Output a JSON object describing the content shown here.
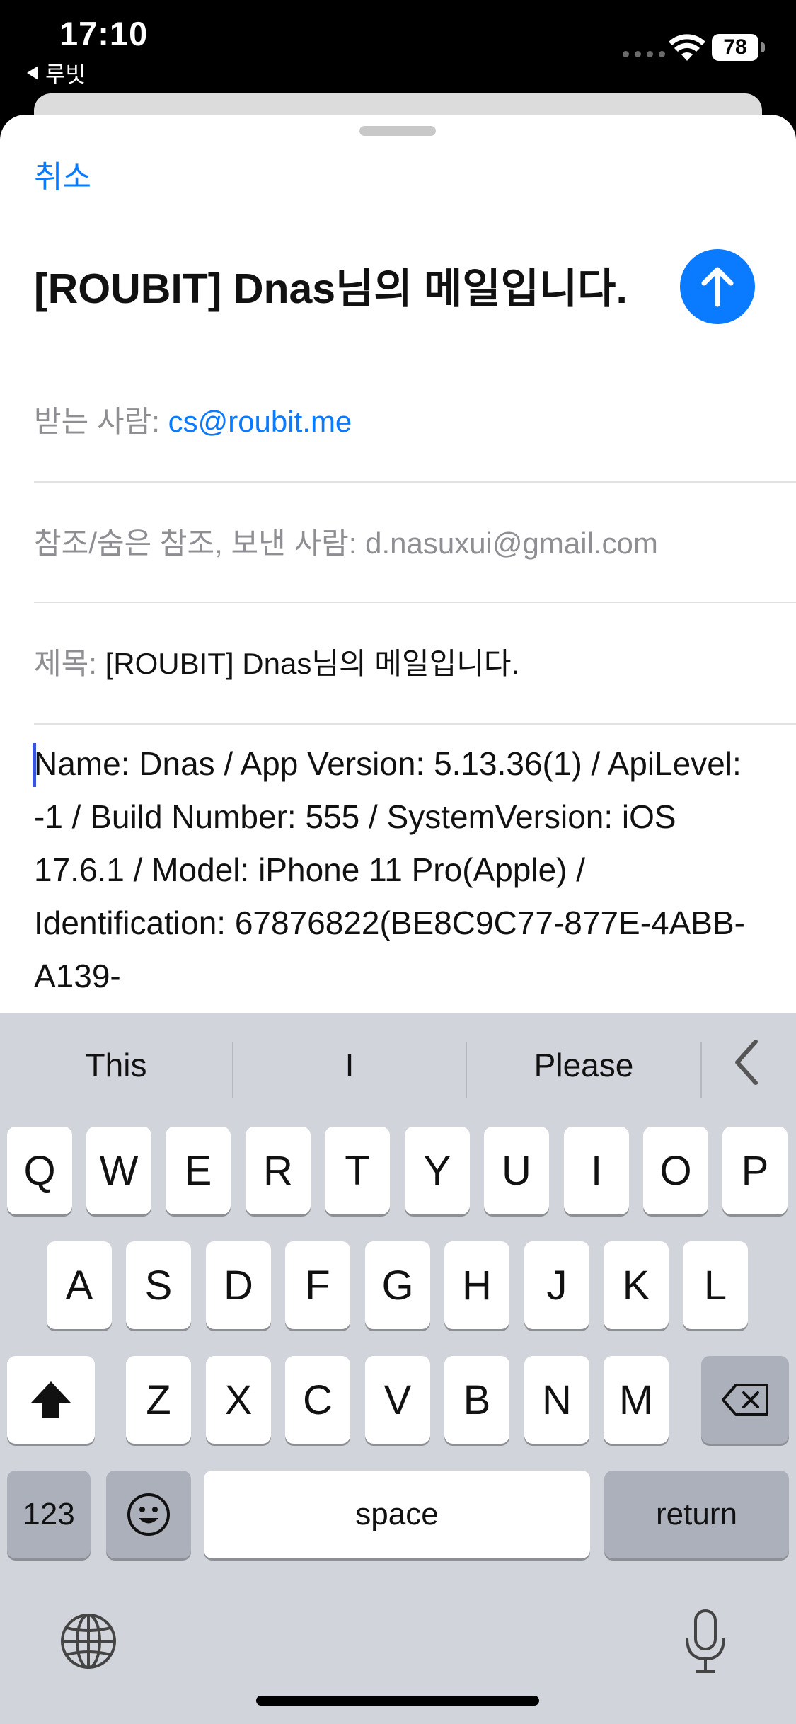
{
  "status_bar": {
    "time": "17:10",
    "back_app": "루빗",
    "battery": "78"
  },
  "compose": {
    "cancel_label": "취소",
    "title": "[ROUBIT] Dnas님의 메일입니다.",
    "to_label": "받는 사람:",
    "to_value": "cs@roubit.me",
    "cc_label": "참조/숨은 참조, 보낸 사람:",
    "cc_value": "d.nasuxui@gmail.com",
    "subject_label": "제목:",
    "subject_value": "[ROUBIT] Dnas님의 메일입니다.",
    "body": "Name: Dnas / App Version: 5.13.36(1) / ApiLevel: -1 / Build Number: 555 / SystemVersion: iOS 17.6.1 / Model: iPhone 11 Pro(Apple) / Identification: 67876822(BE8C9C77-877E-4ABB-A139-"
  },
  "keyboard": {
    "predictions": [
      "This",
      "I",
      "Please"
    ],
    "row1": [
      "Q",
      "W",
      "E",
      "R",
      "T",
      "Y",
      "U",
      "I",
      "O",
      "P"
    ],
    "row2": [
      "A",
      "S",
      "D",
      "F",
      "G",
      "H",
      "J",
      "K",
      "L"
    ],
    "row3": [
      "Z",
      "X",
      "C",
      "V",
      "B",
      "N",
      "M"
    ],
    "numbers_label": "123",
    "space_label": "space",
    "return_label": "return"
  },
  "colors": {
    "accent": "#0a7aff",
    "keyboard_bg": "#d1d4db"
  }
}
